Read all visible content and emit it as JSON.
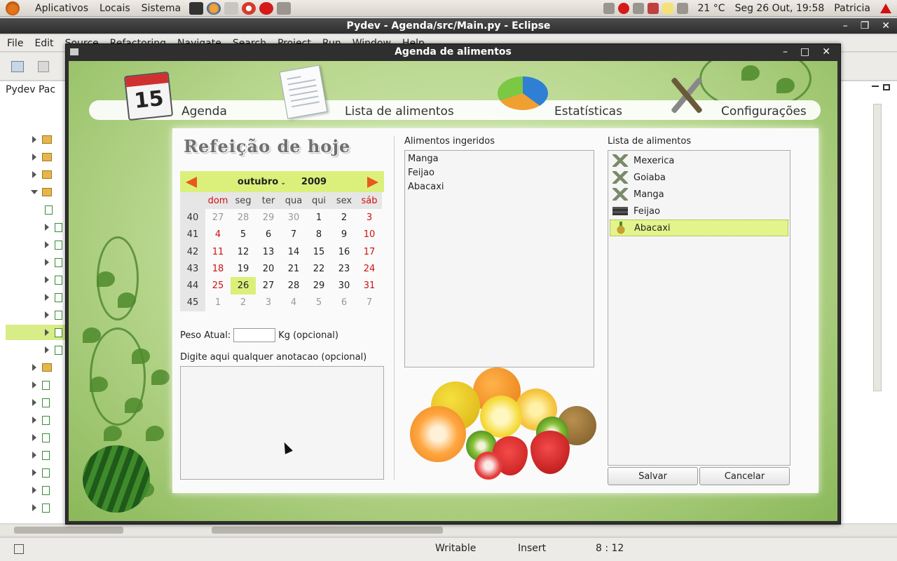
{
  "panel": {
    "menus": [
      "Aplicativos",
      "Locais",
      "Sistema"
    ],
    "weather": "21 °C",
    "clock": "Seg 26 Out, 19:58",
    "user": "Patricia"
  },
  "eclipse": {
    "title": "Pydev - Agenda/src/Main.py - Eclipse",
    "menus": [
      "File",
      "Edit",
      "Source",
      "Refactoring",
      "Navigate",
      "Search",
      "Project",
      "Run",
      "Window",
      "Help"
    ],
    "explorer_tab": "Pydev Pac",
    "status": {
      "writable": "Writable",
      "insert": "Insert",
      "position": "8 : 12"
    }
  },
  "dialog": {
    "title": "Agenda de alimentos",
    "tabs": [
      {
        "label": "Agenda",
        "icon": "calendar-icon"
      },
      {
        "label": "Lista de alimentos",
        "icon": "document-pen-icon"
      },
      {
        "label": "Estatísticas",
        "icon": "pie-chart-icon"
      },
      {
        "label": "Configurações",
        "icon": "tools-icon"
      }
    ],
    "calendar_icon_number": "15",
    "heading": "Refeição de hoje",
    "calendar": {
      "month": "outubro",
      "year": "2009",
      "weekdays": [
        "dom",
        "seg",
        "ter",
        "qua",
        "qui",
        "sex",
        "sáb"
      ],
      "weeks": [
        {
          "num": "40",
          "days": [
            "27",
            "28",
            "29",
            "30",
            "1",
            "2",
            "3"
          ]
        },
        {
          "num": "41",
          "days": [
            "4",
            "5",
            "6",
            "7",
            "8",
            "9",
            "10"
          ]
        },
        {
          "num": "42",
          "days": [
            "11",
            "12",
            "13",
            "14",
            "15",
            "16",
            "17"
          ]
        },
        {
          "num": "43",
          "days": [
            "18",
            "19",
            "20",
            "21",
            "22",
            "23",
            "24"
          ]
        },
        {
          "num": "44",
          "days": [
            "25",
            "26",
            "27",
            "28",
            "29",
            "30",
            "31"
          ]
        },
        {
          "num": "45",
          "days": [
            "1",
            "2",
            "3",
            "4",
            "5",
            "6",
            "7"
          ]
        }
      ],
      "selected_day": "26"
    },
    "peso_label": "Peso Atual:",
    "peso_value": "",
    "peso_unit": "Kg (opcional)",
    "anotacao_label": "Digite aqui qualquer anotacao (opcional)",
    "ingeridos_label": "Alimentos ingeridos",
    "ingeridos": [
      "Manga",
      "Feijao",
      "Abacaxi"
    ],
    "lista_label": "Lista de alimentos",
    "lista": [
      {
        "name": "Mexerica",
        "icon": "missing-image-icon"
      },
      {
        "name": "Goiaba",
        "icon": "missing-image-icon"
      },
      {
        "name": "Manga",
        "icon": "missing-image-icon"
      },
      {
        "name": "Feijao",
        "icon": "beans-icon"
      },
      {
        "name": "Abacaxi",
        "icon": "pineapple-icon",
        "selected": true
      }
    ],
    "save_label": "Salvar",
    "cancel_label": "Cancelar"
  }
}
